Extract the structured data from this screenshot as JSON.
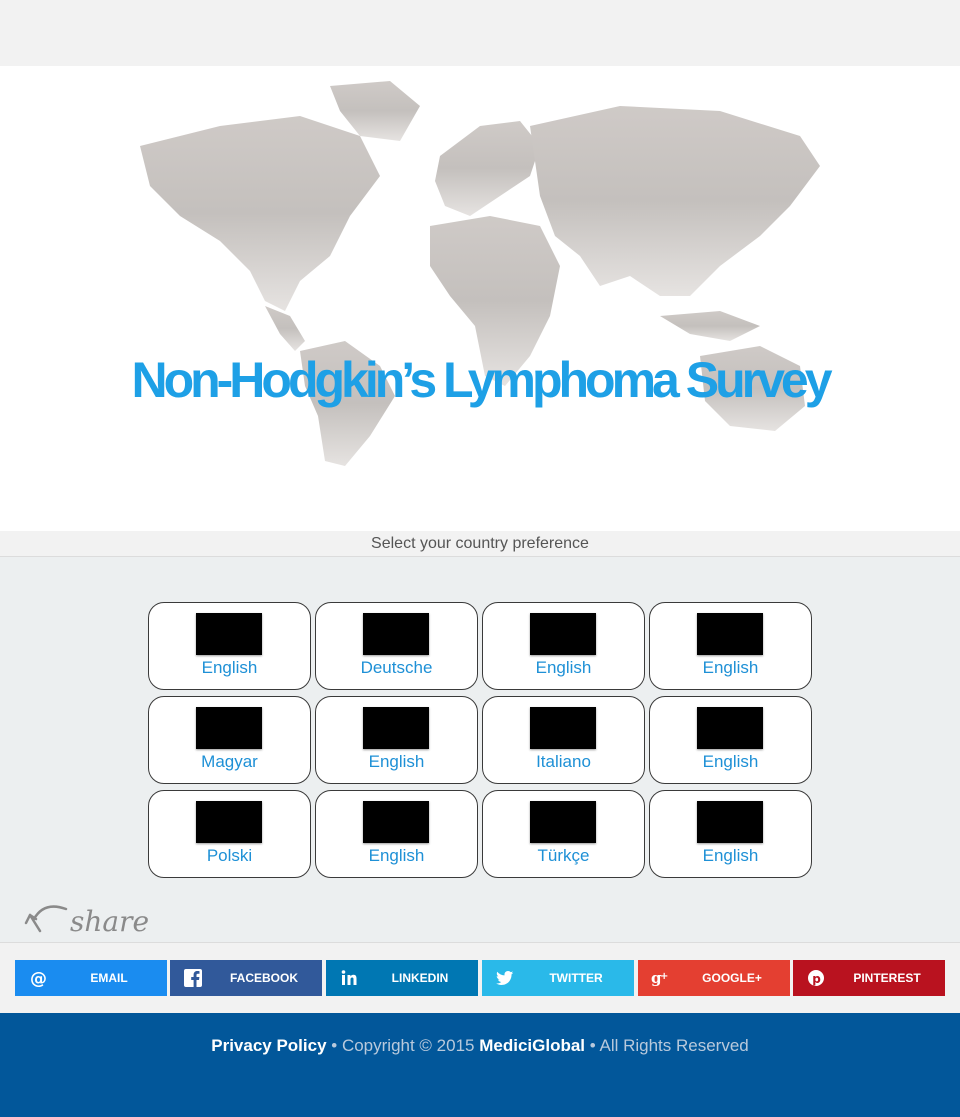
{
  "hero": {
    "title": "Non-Hodgkin’s Lymphoma Survey"
  },
  "prompt": "Select your country preference",
  "countries": [
    {
      "label": "English"
    },
    {
      "label": "Deutsche"
    },
    {
      "label": "English"
    },
    {
      "label": "English"
    },
    {
      "label": "Magyar"
    },
    {
      "label": "English"
    },
    {
      "label": "Italiano"
    },
    {
      "label": "English"
    },
    {
      "label": "Polski"
    },
    {
      "label": "English"
    },
    {
      "label": "Türkçe"
    },
    {
      "label": "English"
    }
  ],
  "share_logo_text": "share",
  "social": [
    {
      "label": "EMAIL",
      "color": "#1a8cf0",
      "icon": "at-icon"
    },
    {
      "label": "FACEBOOK",
      "color": "#31599a",
      "icon": "facebook-icon"
    },
    {
      "label": "LINKEDIN",
      "color": "#0077b3",
      "icon": "linkedin-icon"
    },
    {
      "label": "TWITTER",
      "color": "#2ab9e9",
      "icon": "twitter-icon"
    },
    {
      "label": "GOOGLE+",
      "color": "#e43f31",
      "icon": "google-plus-icon"
    },
    {
      "label": "PINTEREST",
      "color": "#b9121f",
      "icon": "pinterest-icon"
    }
  ],
  "footer": {
    "privacy": "Privacy Policy",
    "sep1": " • Copyright © 2015 ",
    "brand": "MediciGlobal",
    "sep2": " • All Rights Reserved"
  },
  "colors": {
    "title_blue": "#1ea0e6",
    "link_blue": "#1e90d6",
    "footer_bg": "#02579a"
  }
}
